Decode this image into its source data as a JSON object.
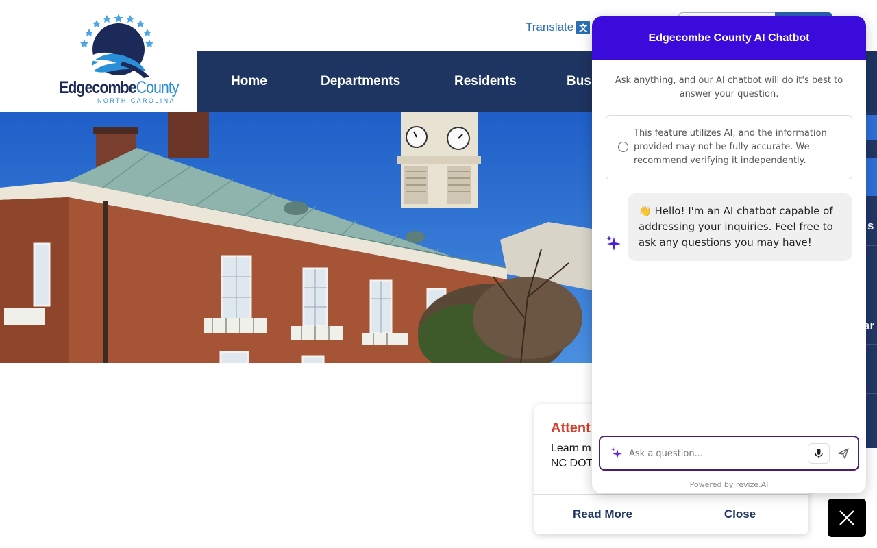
{
  "header": {
    "logo": {
      "name_part1": "Edgecombe",
      "name_part2": "County",
      "subtitle": "NORTH CAROLINA",
      "icon": "county-seal-logo"
    },
    "translate_label": "Translate",
    "translate_icon": "translate-icon"
  },
  "nav": {
    "items": [
      {
        "label": "Home"
      },
      {
        "label": "Departments"
      },
      {
        "label": "Residents"
      },
      {
        "label": "Busi"
      }
    ]
  },
  "side_strip": {
    "fragments": [
      "s",
      "ar"
    ]
  },
  "alert": {
    "title": "Attent",
    "line1": "Learn m",
    "line2": "NC DOT",
    "read_more_label": "Read More",
    "close_label": "Close"
  },
  "chatbot": {
    "title": "Edgecombe County AI Chatbot",
    "intro": "Ask anything, and our AI chatbot will do it's best to answer your question.",
    "disclaimer": "This feature utilizes AI, and the information provided may not be fully accurate. We recommend verifying it independently.",
    "disclaimer_icon": "info-icon",
    "greeting": "👋 Hello! I'm an AI chatbot capable of addressing your inquiries. Feel free to ask any questions you may have!",
    "input_placeholder": "Ask a question...",
    "powered_by_prefix": "Powered by",
    "powered_by_link": "revize.AI",
    "accent_color": "#3b0bdb"
  },
  "fab": {
    "icon": "close-icon"
  }
}
